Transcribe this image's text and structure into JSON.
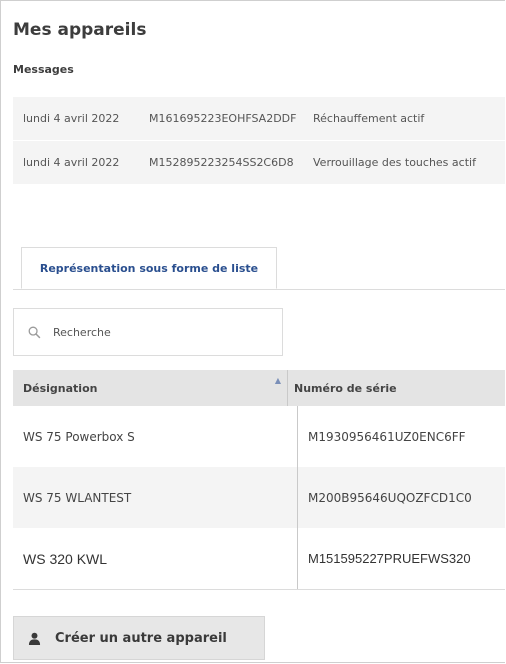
{
  "page": {
    "title": "Mes appareils",
    "messages_title": "Messages"
  },
  "messages": [
    {
      "date": "lundi 4 avril 2022",
      "serial": "M161695223EOHFSA2DDF",
      "text": "Réchauffement actif"
    },
    {
      "date": "lundi 4 avril 2022",
      "serial": "M152895223254SS2C6D8",
      "text": "Verrouillage des touches actif"
    }
  ],
  "tabs": {
    "active_label": "Représentation sous forme de liste"
  },
  "search": {
    "placeholder": "Recherche",
    "icon": "search-icon"
  },
  "table": {
    "headers": {
      "designation": "Désignation",
      "serial": "Numéro de série"
    },
    "sort_icon": "▲",
    "rows": [
      {
        "designation": "WS 75 Powerbox S",
        "serial": "M1930956461UZ0ENC6FF"
      },
      {
        "designation": "WS 75 WLANTEST",
        "serial": "M200B95646UQOZFCD1C0"
      },
      {
        "designation": "WS 320 KWL",
        "serial": "M151595227PRUEFWS320"
      }
    ]
  },
  "actions": {
    "create_label": "Créer un autre appareil",
    "create_icon": "user-icon"
  }
}
